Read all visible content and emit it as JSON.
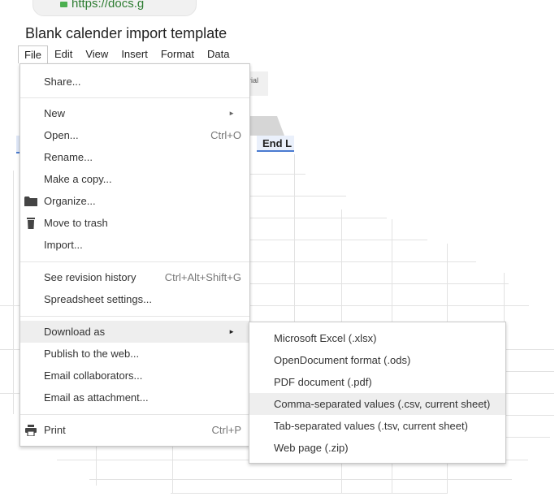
{
  "browser": {
    "url_text": "https://docs.g"
  },
  "document": {
    "title": "Blank calender import template"
  },
  "menubar": {
    "items": [
      "File",
      "Edit",
      "View",
      "Insert",
      "Format",
      "Data"
    ]
  },
  "sheet": {
    "column_header": "End L",
    "toolbar_fragment": "rial"
  },
  "file_menu": {
    "share": "Share...",
    "new": "New",
    "open": "Open...",
    "open_shortcut": "Ctrl+O",
    "rename": "Rename...",
    "make_copy": "Make a copy...",
    "organize": "Organize...",
    "move_to_trash": "Move to trash",
    "import": "Import...",
    "revision_history": "See revision history",
    "revision_history_shortcut": "Ctrl+Alt+Shift+G",
    "spreadsheet_settings": "Spreadsheet settings...",
    "download_as": "Download as",
    "publish": "Publish to the web...",
    "email_collaborators": "Email collaborators...",
    "email_attachment": "Email as attachment...",
    "print": "Print",
    "print_shortcut": "Ctrl+P"
  },
  "download_submenu": {
    "items": [
      "Microsoft Excel (.xlsx)",
      "OpenDocument format (.ods)",
      "PDF document (.pdf)",
      "Comma-separated values (.csv, current sheet)",
      "Tab-separated values (.tsv, current sheet)",
      "Web page (.zip)"
    ],
    "highlighted_index": 3
  },
  "icons": {
    "organize": "folder-icon",
    "trash": "trash-icon",
    "print": "printer-icon",
    "submenu_arrow": "triangle-right-icon",
    "lock": "lock-icon"
  }
}
